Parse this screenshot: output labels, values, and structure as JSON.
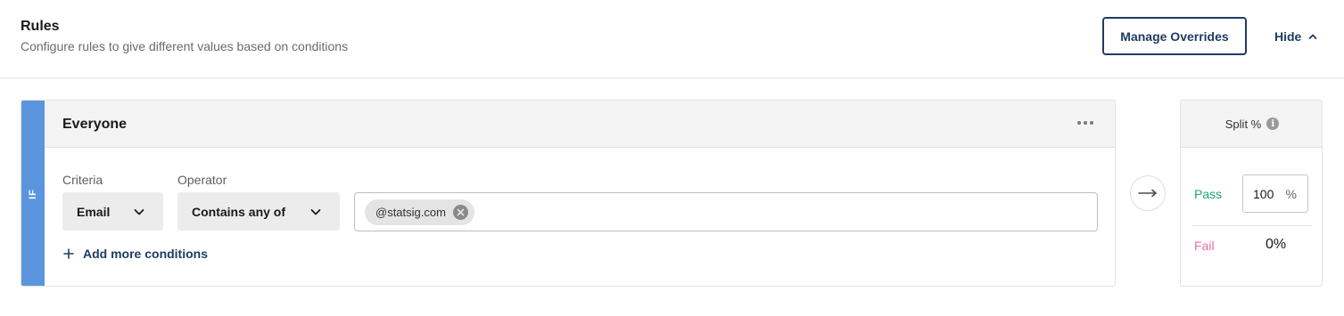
{
  "header": {
    "title": "Rules",
    "subtitle": "Configure rules to give different values based on conditions",
    "manage_overrides_label": "Manage Overrides",
    "hide_label": "Hide"
  },
  "rule": {
    "if_label": "IF",
    "name": "Everyone",
    "criteria_label": "Criteria",
    "criteria_value": "Email",
    "operator_label": "Operator",
    "operator_value": "Contains any of",
    "tags": [
      "@statsig.com"
    ],
    "add_conditions_label": "Add more conditions"
  },
  "split": {
    "title": "Split %",
    "pass_label": "Pass",
    "pass_value": "100",
    "pass_unit": "%",
    "fail_label": "Fail",
    "fail_value": "0%"
  },
  "colors": {
    "accent": "#1f3c63",
    "if_bar": "#5b95dd",
    "pass": "#1aa87a",
    "fail": "#e86fa8"
  },
  "icons": [
    "chevron-up-icon",
    "more-horizontal-icon",
    "chevron-down-icon",
    "close-circle-icon",
    "plus-icon",
    "arrow-right-icon",
    "info-icon"
  ]
}
